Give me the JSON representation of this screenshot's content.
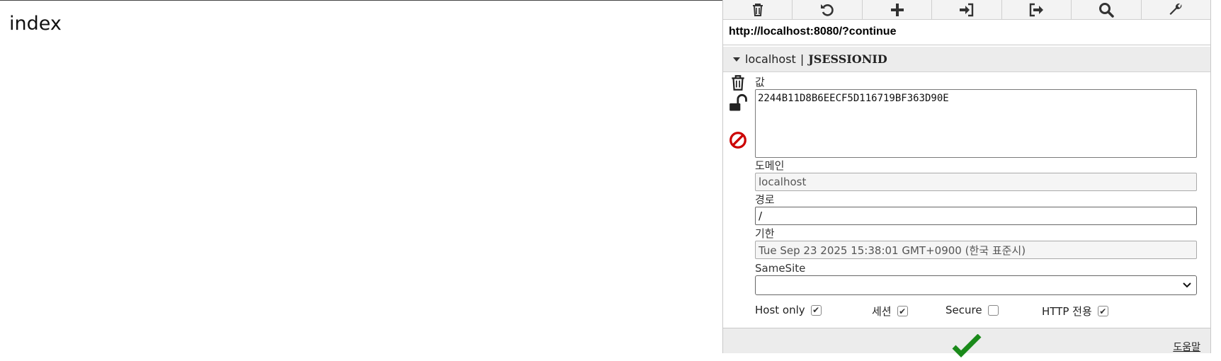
{
  "page": {
    "heading": "index"
  },
  "toolbar": {
    "buttons": [
      {
        "icon": "trash-icon"
      },
      {
        "icon": "refresh-icon"
      },
      {
        "icon": "plus-icon"
      },
      {
        "icon": "import-icon"
      },
      {
        "icon": "export-icon"
      },
      {
        "icon": "search-icon"
      },
      {
        "icon": "wrench-icon"
      }
    ]
  },
  "url": "http://localhost:8080/?continue",
  "cookie": {
    "domain": "localhost",
    "separator": "|",
    "name": "JSESSIONID",
    "value_label": "값",
    "value": "2244B11D8B6EECF5D116719BF363D90E",
    "domain_label": "도메인",
    "domain_value": "localhost",
    "path_label": "경로",
    "path_value": "/",
    "expiry_label": "기한",
    "expiry_value": "Tue Sep 23 2025 15:38:01 GMT+0900 (한국 표준시)",
    "samesite_label": "SameSite",
    "samesite_value": "",
    "flags": {
      "host_only_label": "Host only",
      "host_only": true,
      "session_label": "세션",
      "session": true,
      "secure_label": "Secure",
      "secure": false,
      "http_only_label": "HTTP 전용",
      "http_only": true
    }
  },
  "side_icons": [
    "trash-icon",
    "unlock-icon",
    "block-icon"
  ],
  "footer": {
    "help_label": "도움말",
    "save_icon": "checkmark-icon"
  },
  "colors": {
    "block": "#cc0000",
    "save": "#1a8a1a",
    "panel_header": "#ececec"
  }
}
